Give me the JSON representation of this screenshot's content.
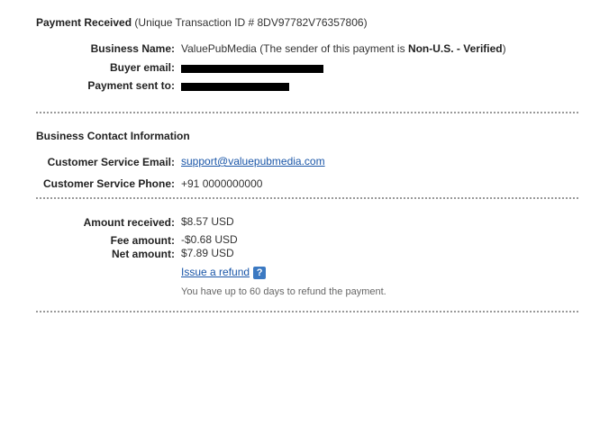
{
  "header": {
    "title": "Payment Received",
    "transaction_label": "(Unique Transaction ID # 8DV97782V76357806)"
  },
  "business": {
    "name_label": "Business Name:",
    "name_value": "ValuePubMedia",
    "sender_prefix": "(The sender of this payment is ",
    "sender_status": "Non-U.S. - Verified",
    "sender_suffix": ")",
    "buyer_email_label": "Buyer email:",
    "payment_sent_to_label": "Payment sent to:"
  },
  "contact": {
    "heading": "Business Contact Information",
    "email_label": "Customer Service Email:",
    "email_value": "support@valuepubmedia.com",
    "phone_label": "Customer Service Phone:",
    "phone_value": "+91 0000000000"
  },
  "amounts": {
    "received_label": "Amount received:",
    "received_value": "$8.57 USD",
    "fee_label": "Fee amount:",
    "fee_value": "-$0.68 USD",
    "net_label": "Net amount:",
    "net_value": "$7.89 USD",
    "refund_link": "Issue a refund",
    "help_icon_glyph": "?",
    "refund_note": "You have up to 60 days to refund the payment."
  },
  "colors": {
    "link": "#1a56a8",
    "help_icon": "#3b79c2"
  }
}
